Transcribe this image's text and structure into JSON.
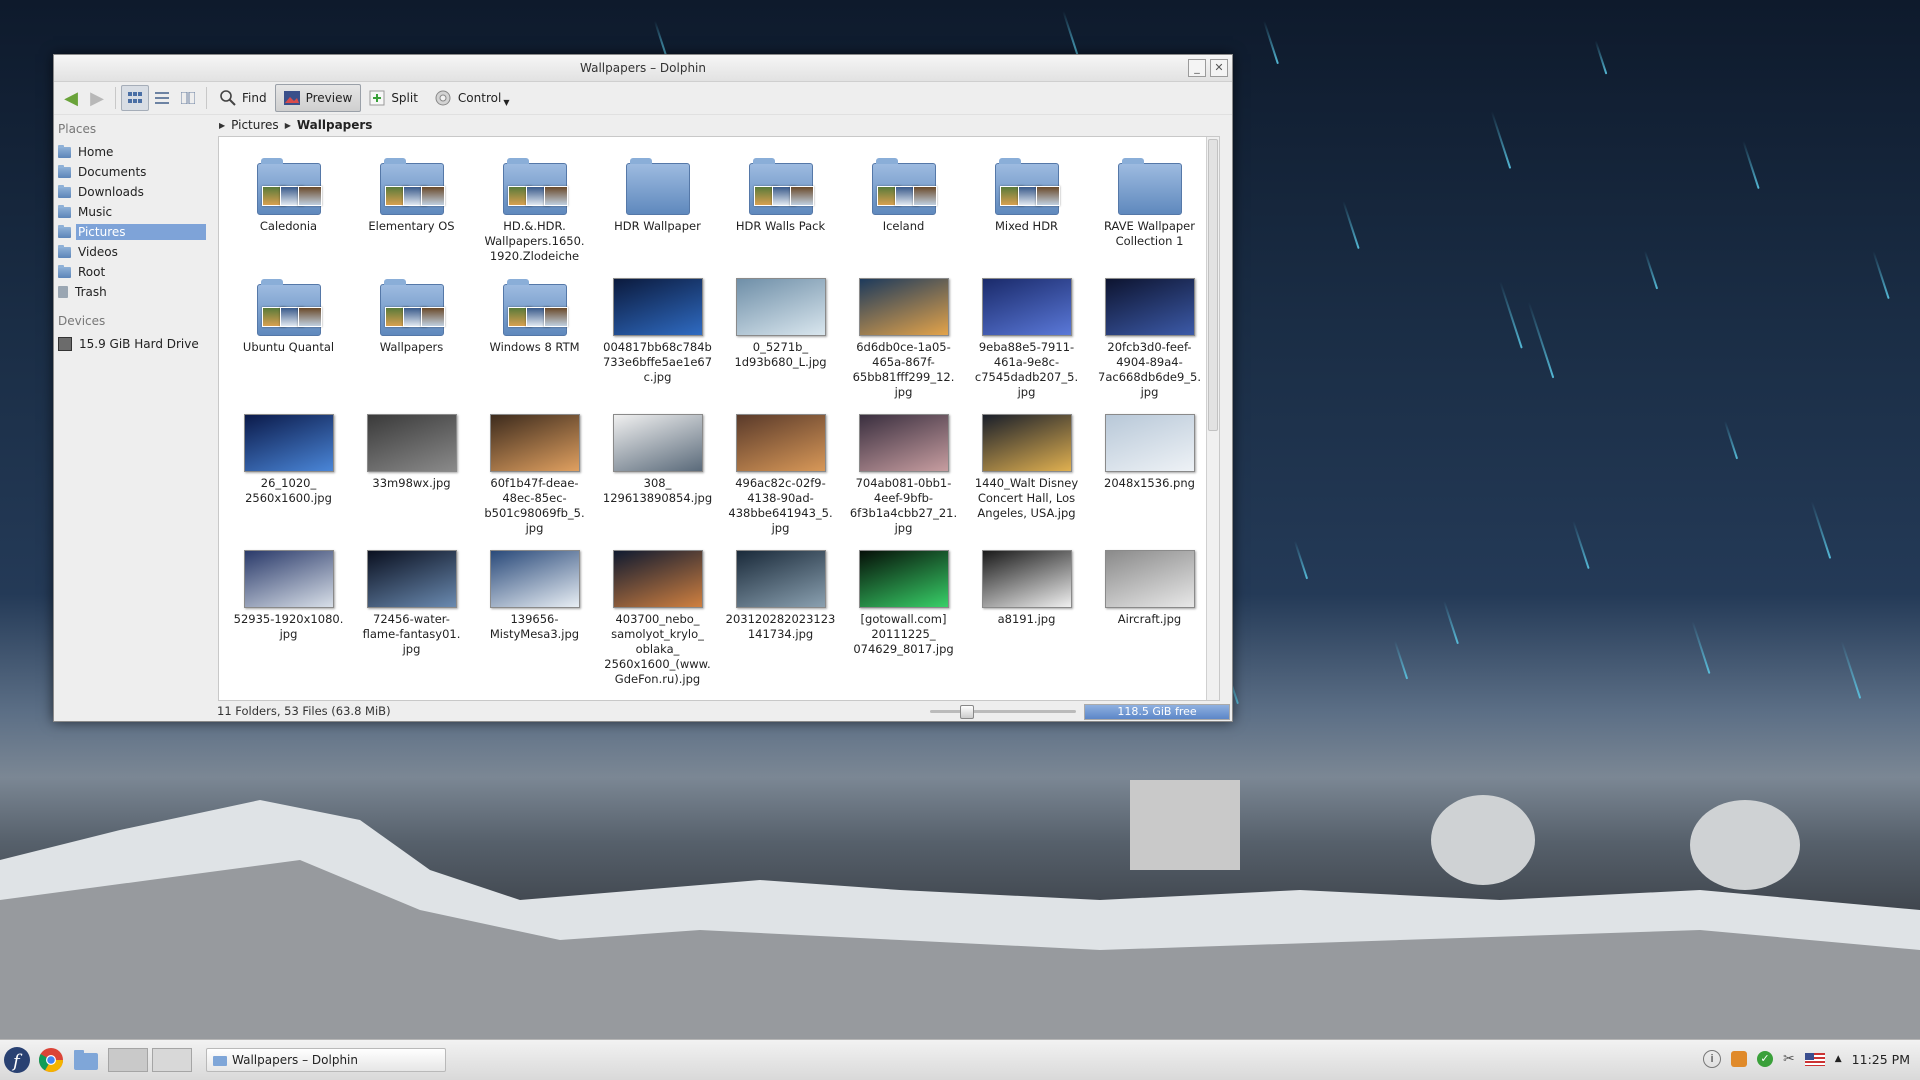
{
  "window": {
    "title": "Wallpapers – Dolphin",
    "minimize": "_",
    "close": "✕"
  },
  "toolbar": {
    "find": "Find",
    "preview": "Preview",
    "split": "Split",
    "control": "Control"
  },
  "sidebar": {
    "places_header": "Places",
    "places": [
      "Home",
      "Documents",
      "Downloads",
      "Music",
      "Pictures",
      "Videos",
      "Root",
      "Trash"
    ],
    "devices_header": "Devices",
    "devices": [
      "15.9 GiB Hard Drive"
    ]
  },
  "breadcrumb": [
    "Pictures",
    "Wallpapers"
  ],
  "files": [
    {
      "name": "Caledonia",
      "kind": "folder"
    },
    {
      "name": "Elementary OS",
      "kind": "folder"
    },
    {
      "name": "HD.&.HDR.\nWallpapers.1650.\n1920.Zlodeiche",
      "kind": "folder"
    },
    {
      "name": "HDR Wallpaper",
      "kind": "folder"
    },
    {
      "name": "HDR Walls Pack",
      "kind": "folder"
    },
    {
      "name": "Iceland",
      "kind": "folder"
    },
    {
      "name": "Mixed HDR",
      "kind": "folder"
    },
    {
      "name": "RAVE Wallpaper\nCollection 1",
      "kind": "folder"
    },
    {
      "name": "Ubuntu Quantal",
      "kind": "folder"
    },
    {
      "name": "Wallpapers",
      "kind": "folder"
    },
    {
      "name": "Windows 8 RTM",
      "kind": "folder"
    },
    {
      "name": "004817bb68c784b\n733e6bffe5ae1e67\nc.jpg",
      "kind": "image"
    },
    {
      "name": "0_5271b_\n1d93b680_L.jpg",
      "kind": "image"
    },
    {
      "name": "6d6db0ce-1a05-\n465a-867f-\n65bb81fff299_12.\njpg",
      "kind": "image"
    },
    {
      "name": "9eba88e5-7911-\n461a-9e8c-\nc7545dadb207_5.\njpg",
      "kind": "image"
    },
    {
      "name": "20fcb3d0-feef-\n4904-89a4-\n7ac668db6de9_5.\njpg",
      "kind": "image"
    },
    {
      "name": "26_1020_\n2560x1600.jpg",
      "kind": "image"
    },
    {
      "name": "33m98wx.jpg",
      "kind": "image"
    },
    {
      "name": "60f1b47f-deae-\n48ec-85ec-\nb501c98069fb_5.\njpg",
      "kind": "image"
    },
    {
      "name": "308_\n129613890854.jpg",
      "kind": "image"
    },
    {
      "name": "496ac82c-02f9-\n4138-90ad-\n438bbe641943_5.\njpg",
      "kind": "image"
    },
    {
      "name": "704ab081-0bb1-\n4eef-9bfb-\n6f3b1a4cbb27_21.\njpg",
      "kind": "image"
    },
    {
      "name": "1440_Walt Disney\nConcert Hall, Los\nAngeles, USA.jpg",
      "kind": "image"
    },
    {
      "name": "2048x1536.png",
      "kind": "image"
    },
    {
      "name": "52935-1920x1080.\njpg",
      "kind": "image"
    },
    {
      "name": "72456-water-\nflame-fantasy01.\njpg",
      "kind": "image"
    },
    {
      "name": "139656-\nMistyMesa3.jpg",
      "kind": "image"
    },
    {
      "name": "403700_nebo_\nsamolyot_krylo_\noblaka_\n2560x1600_(www.\nGdeFon.ru).jpg",
      "kind": "image"
    },
    {
      "name": "203120282023123\n141734.jpg",
      "kind": "image"
    },
    {
      "name": "[gotowall.com]\n20111225_\n074629_8017.jpg",
      "kind": "image"
    },
    {
      "name": "a8191.jpg",
      "kind": "image"
    },
    {
      "name": "Aircraft.jpg",
      "kind": "image"
    }
  ],
  "status": {
    "summary": "11 Folders, 53 Files (63.8 MiB)",
    "free_space": "118.5 GiB free"
  },
  "taskbar": {
    "task_label": "Wallpapers – Dolphin",
    "clock": "11:25 PM"
  }
}
